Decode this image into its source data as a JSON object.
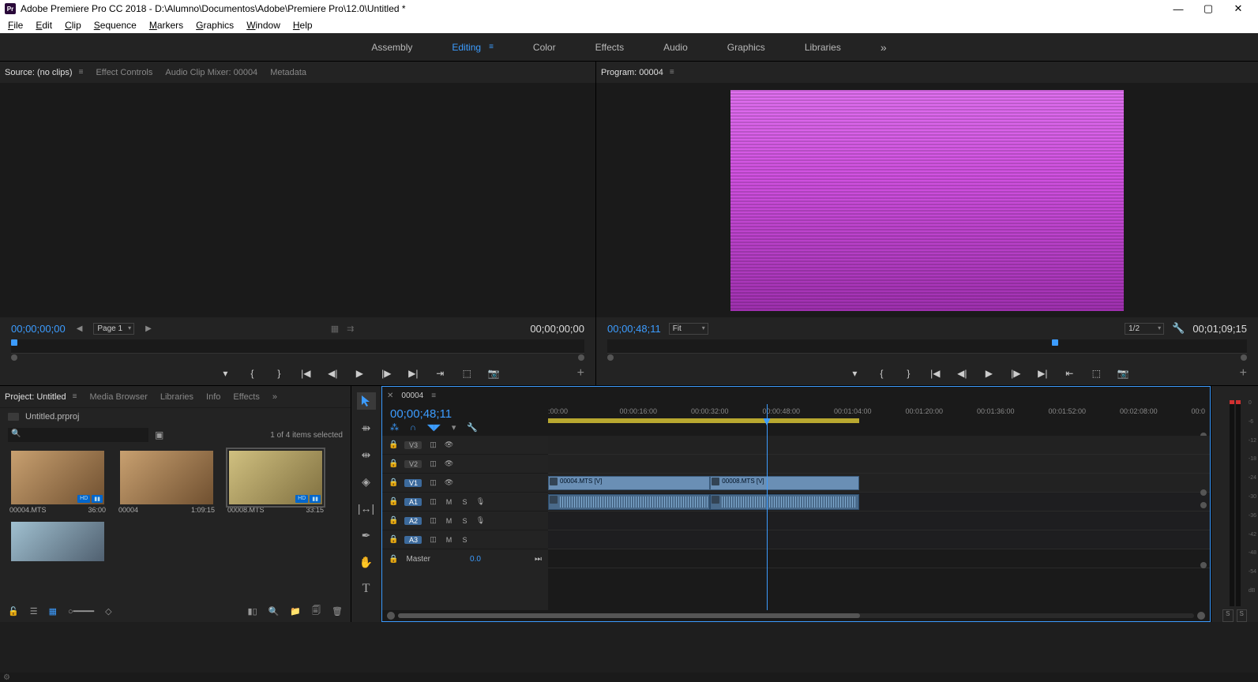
{
  "titlebar": {
    "app_icon": "Pr",
    "title": "Adobe Premiere Pro CC 2018 - D:\\Alumno\\Documentos\\Adobe\\Premiere Pro\\12.0\\Untitled *"
  },
  "menubar": [
    "File",
    "Edit",
    "Clip",
    "Sequence",
    "Markers",
    "Graphics",
    "Window",
    "Help"
  ],
  "workspaces": {
    "items": [
      "Assembly",
      "Editing",
      "Color",
      "Effects",
      "Audio",
      "Graphics",
      "Libraries"
    ],
    "active": "Editing"
  },
  "source_panel": {
    "tabs": [
      "Source: (no clips)",
      "Effect Controls",
      "Audio Clip Mixer: 00004",
      "Metadata"
    ],
    "active_tab": "Source: (no clips)",
    "timecode_left": "00;00;00;00",
    "page_label": "Page 1",
    "timecode_right": "00;00;00;00"
  },
  "program_panel": {
    "tab": "Program: 00004",
    "timecode_left": "00;00;48;11",
    "fit_label": "Fit",
    "zoom_label": "1/2",
    "timecode_right": "00;01;09;15"
  },
  "project_panel": {
    "tabs": [
      "Project: Untitled",
      "Media Browser",
      "Libraries",
      "Info",
      "Effects"
    ],
    "active_tab": "Project: Untitled",
    "project_file": "Untitled.prproj",
    "items_selected": "1 of 4 items selected",
    "clips": [
      {
        "name": "00004.MTS",
        "dur": "36:00",
        "selected": false
      },
      {
        "name": "00004",
        "dur": "1:09:15",
        "selected": false
      },
      {
        "name": "00008.MTS",
        "dur": "33:15",
        "selected": true
      },
      {
        "name": "",
        "dur": "",
        "selected": false
      }
    ]
  },
  "timeline": {
    "sequence_name": "00004",
    "timecode": "00;00;48;11",
    "ruler_ticks": [
      ":00:00",
      "00:00:16:00",
      "00:00:32:00",
      "00:00:48:00",
      "00:01:04:00",
      "00:01:20:00",
      "00:01:36:00",
      "00:01:52:00",
      "00:02:08:00",
      "00:0"
    ],
    "tracks_video": [
      "V3",
      "V2",
      "V1"
    ],
    "tracks_audio": [
      "A1",
      "A2",
      "A3"
    ],
    "selected_tracks": [
      "V1",
      "A1",
      "A2",
      "A3"
    ],
    "master_label": "Master",
    "master_val": "0.0",
    "clip1_label": "00004.MTS [V]",
    "clip2_label": "00008.MTS [V]"
  },
  "audio_meter": {
    "scale": [
      "0",
      "-6",
      "-12",
      "-18",
      "-24",
      "-30",
      "-36",
      "-42",
      "-48",
      "-54",
      "dB"
    ],
    "solo_btn1": "S",
    "solo_btn2": "S"
  }
}
